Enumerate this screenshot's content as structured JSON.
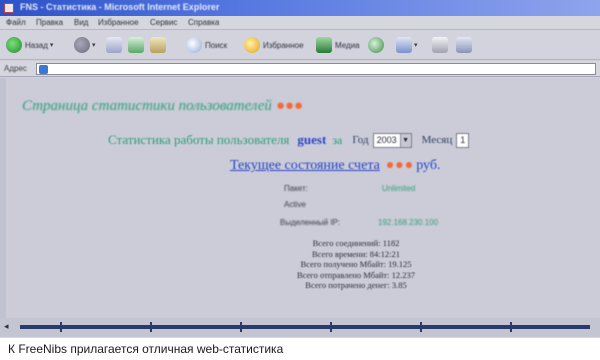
{
  "colors": {
    "accent_green": "#2f9e78",
    "link_blue": "#2b45c8",
    "highlight_orange": "#f26a3a",
    "titlebar_blue": "#2d52c8"
  },
  "titlebar": {
    "title": "FNS - Статистика - Microsoft Internet Explorer"
  },
  "menubar": {
    "items": [
      "Файл",
      "Правка",
      "Вид",
      "Избранное",
      "Сервис",
      "Справка"
    ]
  },
  "toolbar": {
    "back_label": "Назад",
    "search_label": "Поиск",
    "favorites_label": "Избранное",
    "media_label": "Медиа"
  },
  "addressbar": {
    "label": "Адрес"
  },
  "page": {
    "heading": "Страница статистики пользователей",
    "heading_dots": "●●●",
    "stats_title": "Статистика работы пользователя",
    "username": "guest",
    "for_label": "за",
    "year_label": "Год",
    "year_value": "2003",
    "month_label": "Месяц",
    "month_value": "1",
    "balance_link": "Текущее состояние счета",
    "balance_amount": "●●●",
    "currency": "руб.",
    "info": {
      "row1_label": "Пакет:",
      "row1_value": "Unlimited",
      "row2_label": "Active",
      "ip_label": "Выделенный IP:",
      "ip_value": "192.168.230.100"
    },
    "stats": [
      "Всего соединений: 1182",
      "Всего времени: 84:12:21",
      "Всего получено Мбайт: 19.125",
      "Всего отправлено Мбайт: 12.237",
      "Всего потрачено денег: 3.85"
    ]
  },
  "caption": {
    "text": "К FreeNibs прилагается отличная web-статистика"
  }
}
